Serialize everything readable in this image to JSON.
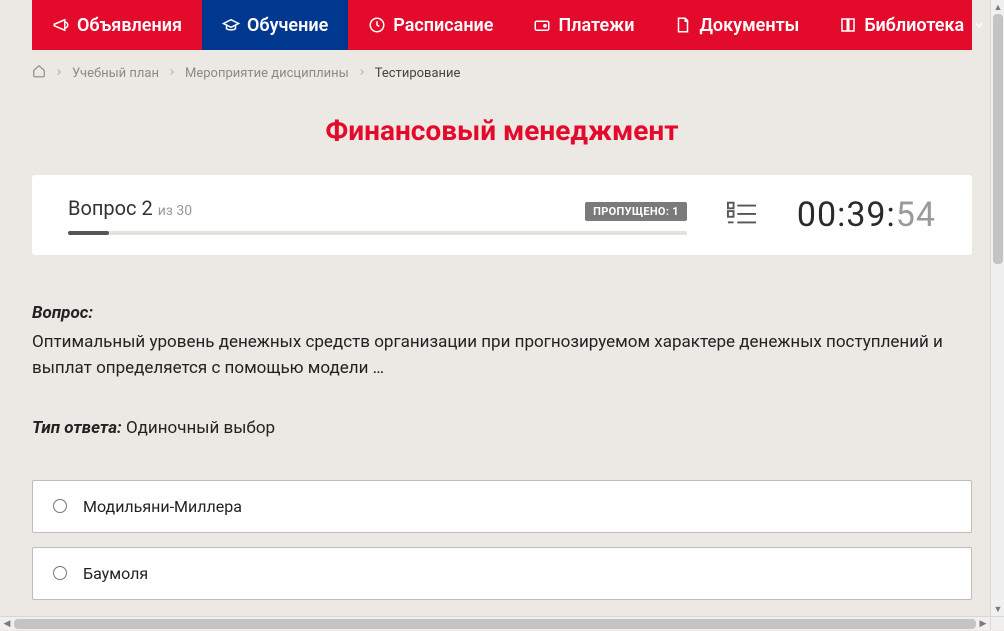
{
  "nav": {
    "items": [
      {
        "label": "Объявления",
        "icon": "megaphone-icon",
        "active": false
      },
      {
        "label": "Обучение",
        "icon": "graduation-cap-icon",
        "active": true
      },
      {
        "label": "Расписание",
        "icon": "clock-icon",
        "active": false
      },
      {
        "label": "Платежи",
        "icon": "wallet-icon",
        "active": false
      },
      {
        "label": "Документы",
        "icon": "document-icon",
        "active": false
      },
      {
        "label": "Библиотека",
        "icon": "book-icon",
        "active": false,
        "dropdown": true
      }
    ]
  },
  "breadcrumb": {
    "items": [
      {
        "label": "Учебный план"
      },
      {
        "label": "Мероприятие дисциплины"
      }
    ],
    "current": "Тестирование"
  },
  "page_title": "Финансовый менеджмент",
  "status": {
    "question_label": "Вопрос 2",
    "total_label": "из 30",
    "skipped_label": "ПРОПУЩЕНО: 1",
    "progress_percent": 6.6,
    "timer": {
      "mm": "00",
      "ss": "39",
      "ms": "54"
    }
  },
  "question": {
    "label": "Вопрос:",
    "text": "Оптимальный уровень денежных средств организации при прогнозируемом характере денежных поступлений и выплат определяется с помощью модели …",
    "answer_type_label": "Тип ответа:",
    "answer_type_value": "Одиночный выбор",
    "options": [
      "Модильяни-Миллера",
      "Баумоля"
    ]
  },
  "colors": {
    "brand_red": "#e30a2b",
    "brand_blue": "#00378f"
  }
}
